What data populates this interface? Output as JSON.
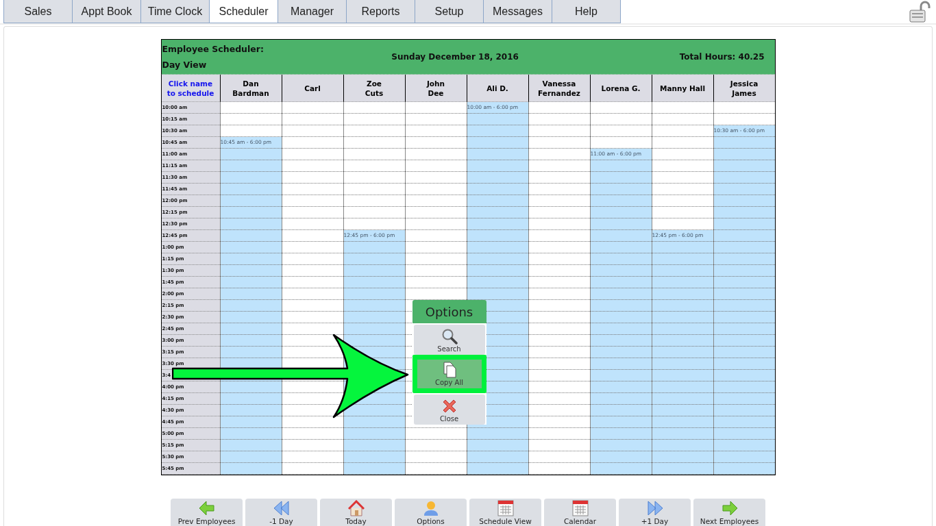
{
  "tabs": [
    {
      "label": "Sales",
      "selected": false
    },
    {
      "label": "Appt Book",
      "selected": false
    },
    {
      "label": "Time Clock",
      "selected": false
    },
    {
      "label": "Scheduler",
      "selected": true
    },
    {
      "label": "Manager",
      "selected": false
    },
    {
      "label": "Reports",
      "selected": false
    },
    {
      "label": "Setup",
      "selected": false
    },
    {
      "label": "Messages",
      "selected": false
    },
    {
      "label": "Help",
      "selected": false
    }
  ],
  "scheduler": {
    "title": "Employee Scheduler:",
    "subtitle": "Day View",
    "date": "Sunday December 18, 2016",
    "total": "Total Hours: 40.25",
    "hint": "Click name to schedule",
    "employees": [
      "Dan\nBardman",
      "Carl",
      "Zoe\nCuts",
      "John\nDee",
      "Ali D.",
      "Vanessa\nFernandez",
      "Lorena G.",
      "Manny Hall",
      "Jessica\nJames"
    ],
    "rows": [
      {
        "time": "10:00 am",
        "cells": [
          {
            "scheduled": false
          },
          {
            "scheduled": false
          },
          {
            "scheduled": false
          },
          {
            "scheduled": false
          },
          {
            "scheduled": true,
            "label": "10:00 am - 6:00 pm"
          },
          {
            "scheduled": false
          },
          {
            "scheduled": false
          },
          {
            "scheduled": false
          },
          {
            "scheduled": false
          }
        ]
      },
      {
        "time": "10:15 am",
        "cells": [
          {
            "scheduled": false
          },
          {
            "scheduled": false
          },
          {
            "scheduled": false
          },
          {
            "scheduled": false
          },
          {
            "scheduled": true
          },
          {
            "scheduled": false
          },
          {
            "scheduled": false
          },
          {
            "scheduled": false
          },
          {
            "scheduled": false
          }
        ]
      },
      {
        "time": "10:30 am",
        "cells": [
          {
            "scheduled": false
          },
          {
            "scheduled": false
          },
          {
            "scheduled": false
          },
          {
            "scheduled": false
          },
          {
            "scheduled": true
          },
          {
            "scheduled": false
          },
          {
            "scheduled": false
          },
          {
            "scheduled": false
          },
          {
            "scheduled": true,
            "label": "10:30 am - 6:00 pm"
          }
        ]
      },
      {
        "time": "10:45 am",
        "cells": [
          {
            "scheduled": true,
            "label": "10:45 am - 6:00 pm"
          },
          {
            "scheduled": false
          },
          {
            "scheduled": false
          },
          {
            "scheduled": false
          },
          {
            "scheduled": true
          },
          {
            "scheduled": false
          },
          {
            "scheduled": false
          },
          {
            "scheduled": false
          },
          {
            "scheduled": true
          }
        ]
      },
      {
        "time": "11:00 am",
        "cells": [
          {
            "scheduled": true
          },
          {
            "scheduled": false
          },
          {
            "scheduled": false
          },
          {
            "scheduled": false
          },
          {
            "scheduled": true
          },
          {
            "scheduled": false
          },
          {
            "scheduled": true,
            "label": "11:00 am - 6:00 pm"
          },
          {
            "scheduled": false
          },
          {
            "scheduled": true
          }
        ]
      },
      {
        "time": "11:15 am",
        "cells": [
          {
            "scheduled": true
          },
          {
            "scheduled": false
          },
          {
            "scheduled": false
          },
          {
            "scheduled": false
          },
          {
            "scheduled": true
          },
          {
            "scheduled": false
          },
          {
            "scheduled": true
          },
          {
            "scheduled": false
          },
          {
            "scheduled": true
          }
        ]
      },
      {
        "time": "11:30 am",
        "cells": [
          {
            "scheduled": true
          },
          {
            "scheduled": false
          },
          {
            "scheduled": false
          },
          {
            "scheduled": false
          },
          {
            "scheduled": true
          },
          {
            "scheduled": false
          },
          {
            "scheduled": true
          },
          {
            "scheduled": false
          },
          {
            "scheduled": true
          }
        ]
      },
      {
        "time": "11:45 am",
        "cells": [
          {
            "scheduled": true
          },
          {
            "scheduled": false
          },
          {
            "scheduled": false
          },
          {
            "scheduled": false
          },
          {
            "scheduled": true
          },
          {
            "scheduled": false
          },
          {
            "scheduled": true
          },
          {
            "scheduled": false
          },
          {
            "scheduled": true
          }
        ]
      },
      {
        "time": "12:00 pm",
        "cells": [
          {
            "scheduled": true
          },
          {
            "scheduled": false
          },
          {
            "scheduled": false
          },
          {
            "scheduled": false
          },
          {
            "scheduled": true
          },
          {
            "scheduled": false
          },
          {
            "scheduled": true
          },
          {
            "scheduled": false
          },
          {
            "scheduled": true
          }
        ]
      },
      {
        "time": "12:15 pm",
        "cells": [
          {
            "scheduled": true
          },
          {
            "scheduled": false
          },
          {
            "scheduled": false
          },
          {
            "scheduled": false
          },
          {
            "scheduled": true
          },
          {
            "scheduled": false
          },
          {
            "scheduled": true
          },
          {
            "scheduled": false
          },
          {
            "scheduled": true
          }
        ]
      },
      {
        "time": "12:30 pm",
        "cells": [
          {
            "scheduled": true
          },
          {
            "scheduled": false
          },
          {
            "scheduled": false
          },
          {
            "scheduled": false
          },
          {
            "scheduled": true
          },
          {
            "scheduled": false
          },
          {
            "scheduled": true
          },
          {
            "scheduled": false
          },
          {
            "scheduled": true
          }
        ]
      },
      {
        "time": "12:45 pm",
        "cells": [
          {
            "scheduled": true
          },
          {
            "scheduled": false
          },
          {
            "scheduled": true,
            "label": "12:45 pm - 6:00 pm"
          },
          {
            "scheduled": false
          },
          {
            "scheduled": true
          },
          {
            "scheduled": false
          },
          {
            "scheduled": true
          },
          {
            "scheduled": true,
            "label": "12:45 pm - 6:00 pm"
          },
          {
            "scheduled": true
          }
        ]
      },
      {
        "time": "1:00 pm",
        "cells": [
          {
            "scheduled": true
          },
          {
            "scheduled": false
          },
          {
            "scheduled": true
          },
          {
            "scheduled": false
          },
          {
            "scheduled": true
          },
          {
            "scheduled": false
          },
          {
            "scheduled": true
          },
          {
            "scheduled": true
          },
          {
            "scheduled": true
          }
        ]
      },
      {
        "time": "1:15 pm",
        "cells": [
          {
            "scheduled": true
          },
          {
            "scheduled": false
          },
          {
            "scheduled": true
          },
          {
            "scheduled": false
          },
          {
            "scheduled": true
          },
          {
            "scheduled": false
          },
          {
            "scheduled": true
          },
          {
            "scheduled": true
          },
          {
            "scheduled": true
          }
        ]
      },
      {
        "time": "1:30 pm",
        "cells": [
          {
            "scheduled": true
          },
          {
            "scheduled": false
          },
          {
            "scheduled": true
          },
          {
            "scheduled": false
          },
          {
            "scheduled": true
          },
          {
            "scheduled": false
          },
          {
            "scheduled": true
          },
          {
            "scheduled": true
          },
          {
            "scheduled": true
          }
        ]
      },
      {
        "time": "1:45 pm",
        "cells": [
          {
            "scheduled": true
          },
          {
            "scheduled": false
          },
          {
            "scheduled": true
          },
          {
            "scheduled": false
          },
          {
            "scheduled": true
          },
          {
            "scheduled": false
          },
          {
            "scheduled": true
          },
          {
            "scheduled": true
          },
          {
            "scheduled": true
          }
        ]
      },
      {
        "time": "2:00 pm",
        "cells": [
          {
            "scheduled": true
          },
          {
            "scheduled": false
          },
          {
            "scheduled": true
          },
          {
            "scheduled": false
          },
          {
            "scheduled": true
          },
          {
            "scheduled": false
          },
          {
            "scheduled": true
          },
          {
            "scheduled": true
          },
          {
            "scheduled": true
          }
        ]
      },
      {
        "time": "2:15 pm",
        "cells": [
          {
            "scheduled": true
          },
          {
            "scheduled": false
          },
          {
            "scheduled": true
          },
          {
            "scheduled": false
          },
          {
            "scheduled": true
          },
          {
            "scheduled": false
          },
          {
            "scheduled": true
          },
          {
            "scheduled": true
          },
          {
            "scheduled": true
          }
        ]
      },
      {
        "time": "2:30 pm",
        "cells": [
          {
            "scheduled": true
          },
          {
            "scheduled": false
          },
          {
            "scheduled": true
          },
          {
            "scheduled": false
          },
          {
            "scheduled": true
          },
          {
            "scheduled": false
          },
          {
            "scheduled": true
          },
          {
            "scheduled": true
          },
          {
            "scheduled": true
          }
        ]
      },
      {
        "time": "2:45 pm",
        "cells": [
          {
            "scheduled": true
          },
          {
            "scheduled": false
          },
          {
            "scheduled": true
          },
          {
            "scheduled": false
          },
          {
            "scheduled": true
          },
          {
            "scheduled": false
          },
          {
            "scheduled": true
          },
          {
            "scheduled": true
          },
          {
            "scheduled": true
          }
        ]
      },
      {
        "time": "3:00 pm",
        "cells": [
          {
            "scheduled": true
          },
          {
            "scheduled": false
          },
          {
            "scheduled": true
          },
          {
            "scheduled": false
          },
          {
            "scheduled": true
          },
          {
            "scheduled": false
          },
          {
            "scheduled": true
          },
          {
            "scheduled": true
          },
          {
            "scheduled": true
          }
        ]
      },
      {
        "time": "3:15 pm",
        "cells": [
          {
            "scheduled": true
          },
          {
            "scheduled": false
          },
          {
            "scheduled": true
          },
          {
            "scheduled": false
          },
          {
            "scheduled": true
          },
          {
            "scheduled": false
          },
          {
            "scheduled": true
          },
          {
            "scheduled": true
          },
          {
            "scheduled": true
          }
        ]
      },
      {
        "time": "3:30 pm",
        "cells": [
          {
            "scheduled": true
          },
          {
            "scheduled": false
          },
          {
            "scheduled": true
          },
          {
            "scheduled": false
          },
          {
            "scheduled": true
          },
          {
            "scheduled": false
          },
          {
            "scheduled": true
          },
          {
            "scheduled": true
          },
          {
            "scheduled": true
          }
        ]
      },
      {
        "time": "3:4",
        "cells": [
          {
            "scheduled": true
          },
          {
            "scheduled": false
          },
          {
            "scheduled": true
          },
          {
            "scheduled": false
          },
          {
            "scheduled": true
          },
          {
            "scheduled": false
          },
          {
            "scheduled": true
          },
          {
            "scheduled": true
          },
          {
            "scheduled": true
          }
        ]
      },
      {
        "time": "4:00 pm",
        "cells": [
          {
            "scheduled": true
          },
          {
            "scheduled": false
          },
          {
            "scheduled": true
          },
          {
            "scheduled": false
          },
          {
            "scheduled": true
          },
          {
            "scheduled": false
          },
          {
            "scheduled": true
          },
          {
            "scheduled": true
          },
          {
            "scheduled": true
          }
        ]
      },
      {
        "time": "4:15 pm",
        "cells": [
          {
            "scheduled": true
          },
          {
            "scheduled": false
          },
          {
            "scheduled": true
          },
          {
            "scheduled": false
          },
          {
            "scheduled": true
          },
          {
            "scheduled": false
          },
          {
            "scheduled": true
          },
          {
            "scheduled": true
          },
          {
            "scheduled": true
          }
        ]
      },
      {
        "time": "4:30 pm",
        "cells": [
          {
            "scheduled": true
          },
          {
            "scheduled": false
          },
          {
            "scheduled": true
          },
          {
            "scheduled": false
          },
          {
            "scheduled": true
          },
          {
            "scheduled": false
          },
          {
            "scheduled": true
          },
          {
            "scheduled": true
          },
          {
            "scheduled": true
          }
        ]
      },
      {
        "time": "4:45 pm",
        "cells": [
          {
            "scheduled": true
          },
          {
            "scheduled": false
          },
          {
            "scheduled": true
          },
          {
            "scheduled": false
          },
          {
            "scheduled": true
          },
          {
            "scheduled": false
          },
          {
            "scheduled": true
          },
          {
            "scheduled": true
          },
          {
            "scheduled": true
          }
        ]
      },
      {
        "time": "5:00 pm",
        "cells": [
          {
            "scheduled": true
          },
          {
            "scheduled": false
          },
          {
            "scheduled": true
          },
          {
            "scheduled": false
          },
          {
            "scheduled": true
          },
          {
            "scheduled": false
          },
          {
            "scheduled": true
          },
          {
            "scheduled": true
          },
          {
            "scheduled": true
          }
        ]
      },
      {
        "time": "5:15 pm",
        "cells": [
          {
            "scheduled": true
          },
          {
            "scheduled": false
          },
          {
            "scheduled": true
          },
          {
            "scheduled": false
          },
          {
            "scheduled": true
          },
          {
            "scheduled": false
          },
          {
            "scheduled": true
          },
          {
            "scheduled": true
          },
          {
            "scheduled": true
          }
        ]
      },
      {
        "time": "5:30 pm",
        "cells": [
          {
            "scheduled": true
          },
          {
            "scheduled": false
          },
          {
            "scheduled": true
          },
          {
            "scheduled": false
          },
          {
            "scheduled": true
          },
          {
            "scheduled": false
          },
          {
            "scheduled": true
          },
          {
            "scheduled": true
          },
          {
            "scheduled": true
          }
        ]
      },
      {
        "time": "5:45 pm",
        "cells": [
          {
            "scheduled": true
          },
          {
            "scheduled": false
          },
          {
            "scheduled": true
          },
          {
            "scheduled": false
          },
          {
            "scheduled": true
          },
          {
            "scheduled": false
          },
          {
            "scheduled": true
          },
          {
            "scheduled": true
          },
          {
            "scheduled": true
          }
        ]
      }
    ]
  },
  "options_menu": {
    "title": "Options",
    "items": [
      {
        "label": "Search",
        "highlighted": false
      },
      {
        "label": "Copy All",
        "highlighted": true
      },
      {
        "label": "Close",
        "highlighted": false
      }
    ]
  },
  "toolbar": [
    {
      "label": "Prev Employees"
    },
    {
      "label": "-1 Day"
    },
    {
      "label": "Today"
    },
    {
      "label": "Options"
    },
    {
      "label": "Schedule View"
    },
    {
      "label": "Calendar"
    },
    {
      "label": "+1 Day"
    },
    {
      "label": "Next Employees"
    }
  ]
}
